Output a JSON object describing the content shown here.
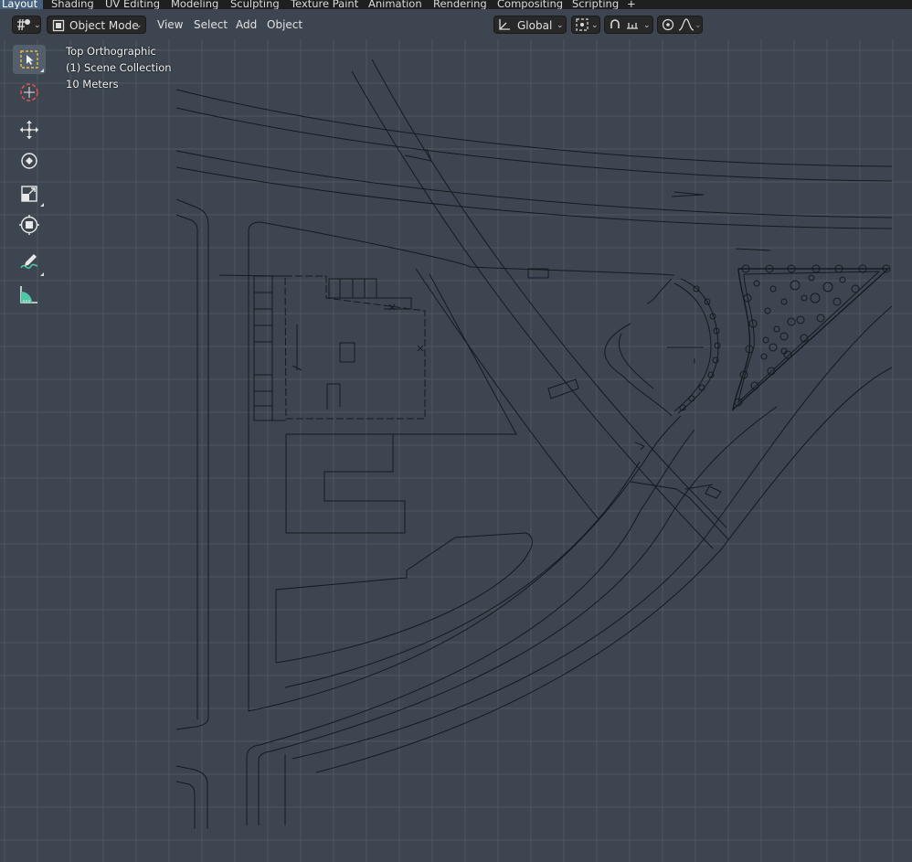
{
  "workspace_tabs": [
    "Layout",
    "Shading",
    "UV Editing",
    "Modeling",
    "Sculpting",
    "Texture Paint",
    "Animation",
    "Rendering",
    "Compositing",
    "Scripting",
    "+"
  ],
  "header": {
    "mode": "Object Mode",
    "menus": [
      "View",
      "Select",
      "Add",
      "Object"
    ],
    "transform_orientation": "Global"
  },
  "viewport": {
    "view_name": "Top Orthographic",
    "collection": "(1) Scene Collection",
    "scale": "10 Meters"
  },
  "toolbar": [
    {
      "name": "select-box-tool",
      "icon": "select-box-icon",
      "active": true
    },
    {
      "name": "cursor-tool",
      "icon": "cursor-icon",
      "active": false
    },
    {
      "name": "move-tool",
      "icon": "move-icon",
      "active": false
    },
    {
      "name": "rotate-tool",
      "icon": "rotate-icon",
      "active": false
    },
    {
      "name": "scale-tool",
      "icon": "scale-icon",
      "active": false
    },
    {
      "name": "transform-tool",
      "icon": "transform-icon",
      "active": false
    },
    {
      "name": "annotate-tool",
      "icon": "annotate-icon",
      "active": false
    },
    {
      "name": "measure-tool",
      "icon": "measure-icon",
      "active": false
    }
  ],
  "colors": {
    "viewport_bg": "#3d4650",
    "grid_line": "#4f5862",
    "drawing_line": "#141a20",
    "active_tab": "#45617e"
  }
}
